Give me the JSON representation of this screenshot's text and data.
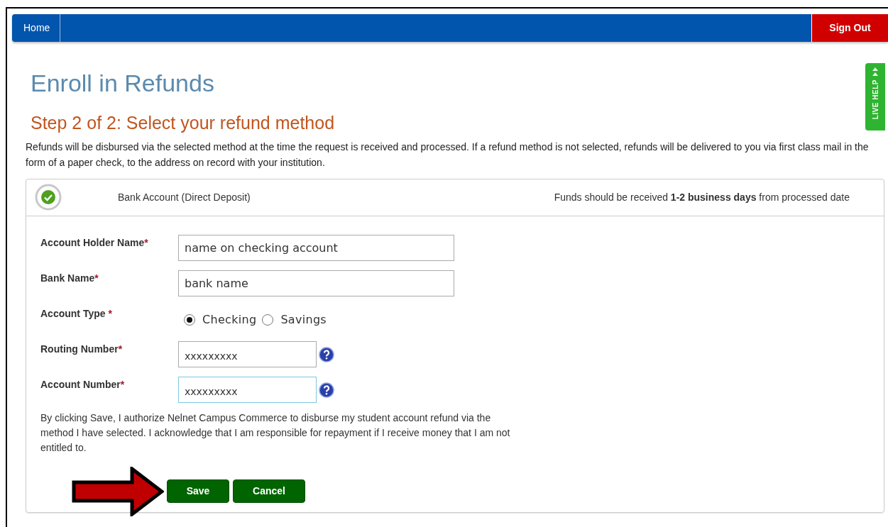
{
  "nav": {
    "items": [
      {
        "label": "Home"
      }
    ],
    "sign_out": "Sign Out"
  },
  "title": "Enroll in Refunds",
  "step": "Step 2 of 2: Select your refund method",
  "intro": "Refunds will be disbursed via the selected method at the time the request is received and processed. If a refund method is not selected, refunds will be delivered to you via first class mail in the form of a paper check, to the address on record with your institution.",
  "method": {
    "selected": true,
    "label": "Bank Account (Direct Deposit)",
    "note": "Funds should be received **1-2 business days** from processed date"
  },
  "fields": [
    {
      "kind": "text",
      "label": "Account Holder Name",
      "mark": "*",
      "value": "name on checking account",
      "focused": false,
      "help": false
    },
    {
      "kind": "text",
      "label": "Bank Name",
      "mark": "*",
      "value": "bank name",
      "focused": false,
      "help": false
    },
    {
      "kind": "radio",
      "label": "Account Type",
      "mark": "*",
      "options": [
        {
          "label": "Checking",
          "selected": true
        },
        {
          "label": "Savings",
          "selected": false
        }
      ]
    },
    {
      "kind": "short",
      "label": "Routing Number",
      "mark": "*",
      "value": "xxxxxxxxx",
      "focused": false,
      "help": true
    },
    {
      "kind": "short",
      "label": "Account Number",
      "mark": "*",
      "value": "xxxxxxxxx",
      "focused": true,
      "help": true
    }
  ],
  "consent": "By clicking Save, I authorize Nelnet Campus Commerce to disburse my student account refund via the method I have selected. I acknowledge that I am responsible for repayment if I receive money that I am not entitled to.",
  "buttons": [
    {
      "label": "Save"
    },
    {
      "label": "Cancel"
    }
  ],
  "live_help": "LIVE HELP"
}
